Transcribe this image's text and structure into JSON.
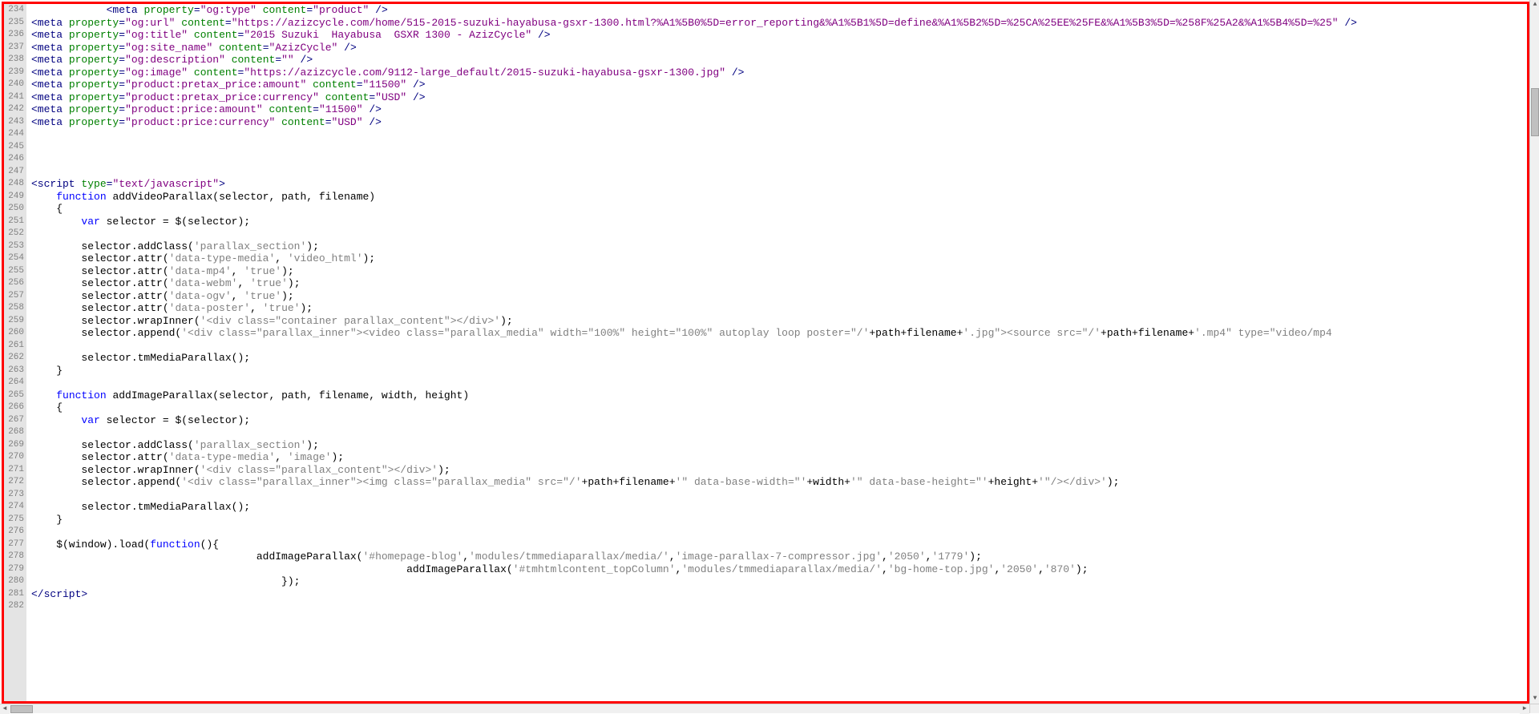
{
  "first_line_number": 234,
  "lines": [
    {
      "n": 234,
      "kind": "meta",
      "indent": "            ",
      "prop": "og:type",
      "content": "product"
    },
    {
      "n": 235,
      "kind": "meta",
      "indent": "",
      "prop": "og:url",
      "content": "https://azizcycle.com/home/515-2015-suzuki-hayabusa-gsxr-1300.html?%A1%5B0%5D=error_reporting&%A1%5B1%5D=define&%A1%5B2%5D=%25CA%25EE%25FE&%A1%5B3%5D=%258F%25A2&%A1%5B4%5D=%25"
    },
    {
      "n": 236,
      "kind": "meta",
      "indent": "",
      "prop": "og:title",
      "content": "2015 Suzuki  Hayabusa  GSXR 1300 - AzizCycle"
    },
    {
      "n": 237,
      "kind": "meta",
      "indent": "",
      "prop": "og:site_name",
      "content": "AzizCycle"
    },
    {
      "n": 238,
      "kind": "meta",
      "indent": "",
      "prop": "og:description",
      "content": ""
    },
    {
      "n": 239,
      "kind": "meta",
      "indent": "",
      "prop": "og:image",
      "content": "https://azizcycle.com/9112-large_default/2015-suzuki-hayabusa-gsxr-1300.jpg"
    },
    {
      "n": 240,
      "kind": "meta",
      "indent": "",
      "prop": "product:pretax_price:amount",
      "content": "11500"
    },
    {
      "n": 241,
      "kind": "meta",
      "indent": "",
      "prop": "product:pretax_price:currency",
      "content": "USD"
    },
    {
      "n": 242,
      "kind": "meta",
      "indent": "",
      "prop": "product:price:amount",
      "content": "11500"
    },
    {
      "n": 243,
      "kind": "meta",
      "indent": "",
      "prop": "product:price:currency",
      "content": "USD"
    },
    {
      "n": 244,
      "kind": "blank"
    },
    {
      "n": 245,
      "kind": "blank"
    },
    {
      "n": 246,
      "kind": "blank"
    },
    {
      "n": 247,
      "kind": "blank"
    },
    {
      "n": 248,
      "kind": "script_open",
      "text": "<script type=\"text/javascript\">"
    },
    {
      "n": 249,
      "kind": "js",
      "text": "    function addVideoParallax(selector, path, filename)"
    },
    {
      "n": 250,
      "kind": "js",
      "text": "    {"
    },
    {
      "n": 251,
      "kind": "js",
      "text": "        var selector = $(selector);"
    },
    {
      "n": 252,
      "kind": "blank"
    },
    {
      "n": 253,
      "kind": "js",
      "text": "        selector.addClass('parallax_section');"
    },
    {
      "n": 254,
      "kind": "js",
      "text": "        selector.attr('data-type-media', 'video_html');"
    },
    {
      "n": 255,
      "kind": "js",
      "text": "        selector.attr('data-mp4', 'true');"
    },
    {
      "n": 256,
      "kind": "js",
      "text": "        selector.attr('data-webm', 'true');"
    },
    {
      "n": 257,
      "kind": "js",
      "text": "        selector.attr('data-ogv', 'true');"
    },
    {
      "n": 258,
      "kind": "js",
      "text": "        selector.attr('data-poster', 'true');"
    },
    {
      "n": 259,
      "kind": "js",
      "text": "        selector.wrapInner('<div class=\"container parallax_content\"></div>');"
    },
    {
      "n": 260,
      "kind": "js",
      "text": "        selector.append('<div class=\"parallax_inner\"><video class=\"parallax_media\" width=\"100%\" height=\"100%\" autoplay loop poster=\"/'+path+filename+'.jpg\"><source src=\"/'+path+filename+'.mp4\" type=\"video/mp4"
    },
    {
      "n": 261,
      "kind": "blank"
    },
    {
      "n": 262,
      "kind": "js",
      "text": "        selector.tmMediaParallax();"
    },
    {
      "n": 263,
      "kind": "js",
      "text": "    }"
    },
    {
      "n": 264,
      "kind": "blank"
    },
    {
      "n": 265,
      "kind": "js",
      "text": "    function addImageParallax(selector, path, filename, width, height)"
    },
    {
      "n": 266,
      "kind": "js",
      "text": "    {"
    },
    {
      "n": 267,
      "kind": "js",
      "text": "        var selector = $(selector);"
    },
    {
      "n": 268,
      "kind": "blank"
    },
    {
      "n": 269,
      "kind": "js",
      "text": "        selector.addClass('parallax_section');"
    },
    {
      "n": 270,
      "kind": "js",
      "text": "        selector.attr('data-type-media', 'image');"
    },
    {
      "n": 271,
      "kind": "js",
      "text": "        selector.wrapInner('<div class=\"parallax_content\"></div>');"
    },
    {
      "n": 272,
      "kind": "js",
      "text": "        selector.append('<div class=\"parallax_inner\"><img class=\"parallax_media\" src=\"/'+path+filename+'\" data-base-width=\"'+width+'\" data-base-height=\"'+height+'\"/></div>');"
    },
    {
      "n": 273,
      "kind": "blank"
    },
    {
      "n": 274,
      "kind": "js",
      "text": "        selector.tmMediaParallax();"
    },
    {
      "n": 275,
      "kind": "js",
      "text": "    }"
    },
    {
      "n": 276,
      "kind": "blank"
    },
    {
      "n": 277,
      "kind": "js",
      "text": "    $(window).load(function(){"
    },
    {
      "n": 278,
      "kind": "js",
      "text": "                                    addImageParallax('#homepage-blog','modules/tmmediaparallax/media/','image-parallax-7-compressor.jpg','2050','1779');"
    },
    {
      "n": 279,
      "kind": "js",
      "text": "                                                            addImageParallax('#tmhtmlcontent_topColumn','modules/tmmediaparallax/media/','bg-home-top.jpg','2050','870');"
    },
    {
      "n": 280,
      "kind": "js",
      "text": "                                        });"
    },
    {
      "n": 281,
      "kind": "script_close",
      "text": "</script>"
    },
    {
      "n": 282,
      "kind": "blank"
    }
  ]
}
